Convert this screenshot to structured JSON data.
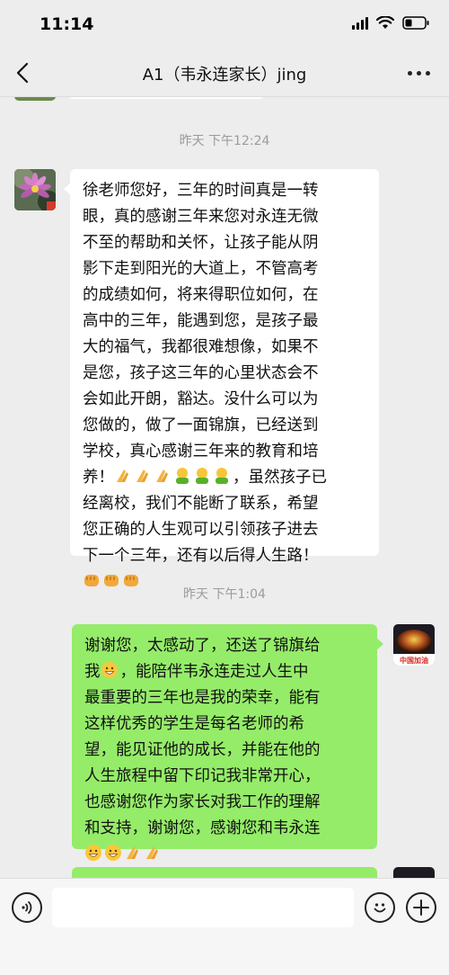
{
  "status_bar": {
    "time": "11:14"
  },
  "nav": {
    "title": "A1（韦永连家长）jing"
  },
  "messages": [
    {
      "timestamp": "昨天 下午12:24"
    },
    {
      "direction": "in",
      "lines": [
        "徐老师您好，三年的时间真是一转",
        "眼，真的感谢三年来您对永连无微",
        "不至的帮助和关怀，让孩子能从阴",
        "影下走到阳光的大道上，不管高考",
        "的成绩如何，将来得职位如何，在",
        "高中的三年，能遇到您，是孩子最",
        "大的福气，我都很难想像，如果不",
        "是您，孩子这三年的心里状态会不",
        "会如此开朗，豁达。没什么可以为",
        "您做的，做了一面锦旗，已经送到",
        "学校，真心感谢三年来的教育和培",
        "养！",
        "经离校，我们不能断了联系，希望",
        "您正确的人生观可以引领孩子进去",
        "下一个三年，还有以后得人生路！"
      ],
      "line12_suffix": "，虽然孩子已"
    },
    {
      "timestamp": "昨天 下午1:04"
    },
    {
      "direction": "out",
      "lines": [
        "谢谢您，太感动了，还送了锦旗给",
        "我",
        "，能陪伴韦永连走过人生中",
        "最重要的三年也是我的荣幸，能有",
        "这样优秀的学生是每名老师的希",
        "望，能见证他的成长，并能在他的",
        "人生旅程中留下印记我非常开心，",
        "也感谢您作为家长对我工作的理解",
        "和支持，谢谢您，感谢您和韦永连"
      ]
    }
  ],
  "teacher_avatar_text": "中国加油",
  "colors": {
    "out_bubble": "#95ec69",
    "in_bubble": "#ffffff",
    "background": "#ededed"
  },
  "icons": [
    "back-icon",
    "more-icon",
    "voice-icon",
    "emoji-icon",
    "plus-icon"
  ]
}
